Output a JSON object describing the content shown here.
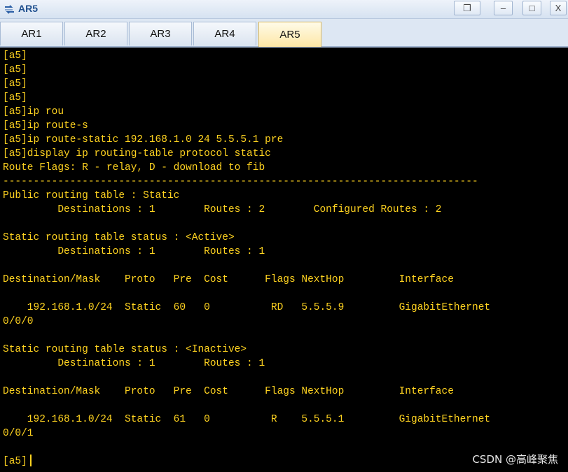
{
  "window": {
    "title": "AR5",
    "buttons": {
      "restore": "❐",
      "minimize": "–",
      "maximize": "□",
      "close": "X"
    }
  },
  "tabs": [
    {
      "label": "AR1",
      "active": false
    },
    {
      "label": "AR2",
      "active": false
    },
    {
      "label": "AR3",
      "active": false
    },
    {
      "label": "AR4",
      "active": false
    },
    {
      "label": "AR5",
      "active": true
    }
  ],
  "terminal": {
    "text_color": "#ffd320",
    "background": "#000000",
    "lines": [
      "[a5]",
      "[a5]",
      "[a5]",
      "[a5]",
      "[a5]ip rou",
      "[a5]ip route-s",
      "[a5]ip route-static 192.168.1.0 24 5.5.5.1 pre",
      "[a5]display ip routing-table protocol static",
      "Route Flags: R - relay, D - download to fib",
      "------------------------------------------------------------------------------",
      "Public routing table : Static",
      "         Destinations : 1        Routes : 2        Configured Routes : 2",
      "",
      "Static routing table status : <Active>",
      "         Destinations : 1        Routes : 1",
      "",
      "Destination/Mask    Proto   Pre  Cost      Flags NextHop         Interface",
      "",
      "    192.168.1.0/24  Static  60   0          RD   5.5.5.9         GigabitEthernet",
      "0/0/0",
      "",
      "Static routing table status : <Inactive>",
      "         Destinations : 1        Routes : 1",
      "",
      "Destination/Mask    Proto   Pre  Cost      Flags NextHop         Interface",
      "",
      "    192.168.1.0/24  Static  61   0          R    5.5.5.1         GigabitEthernet",
      "0/0/1",
      "",
      "[a5]"
    ]
  },
  "watermark": "CSDN @高峰聚焦"
}
